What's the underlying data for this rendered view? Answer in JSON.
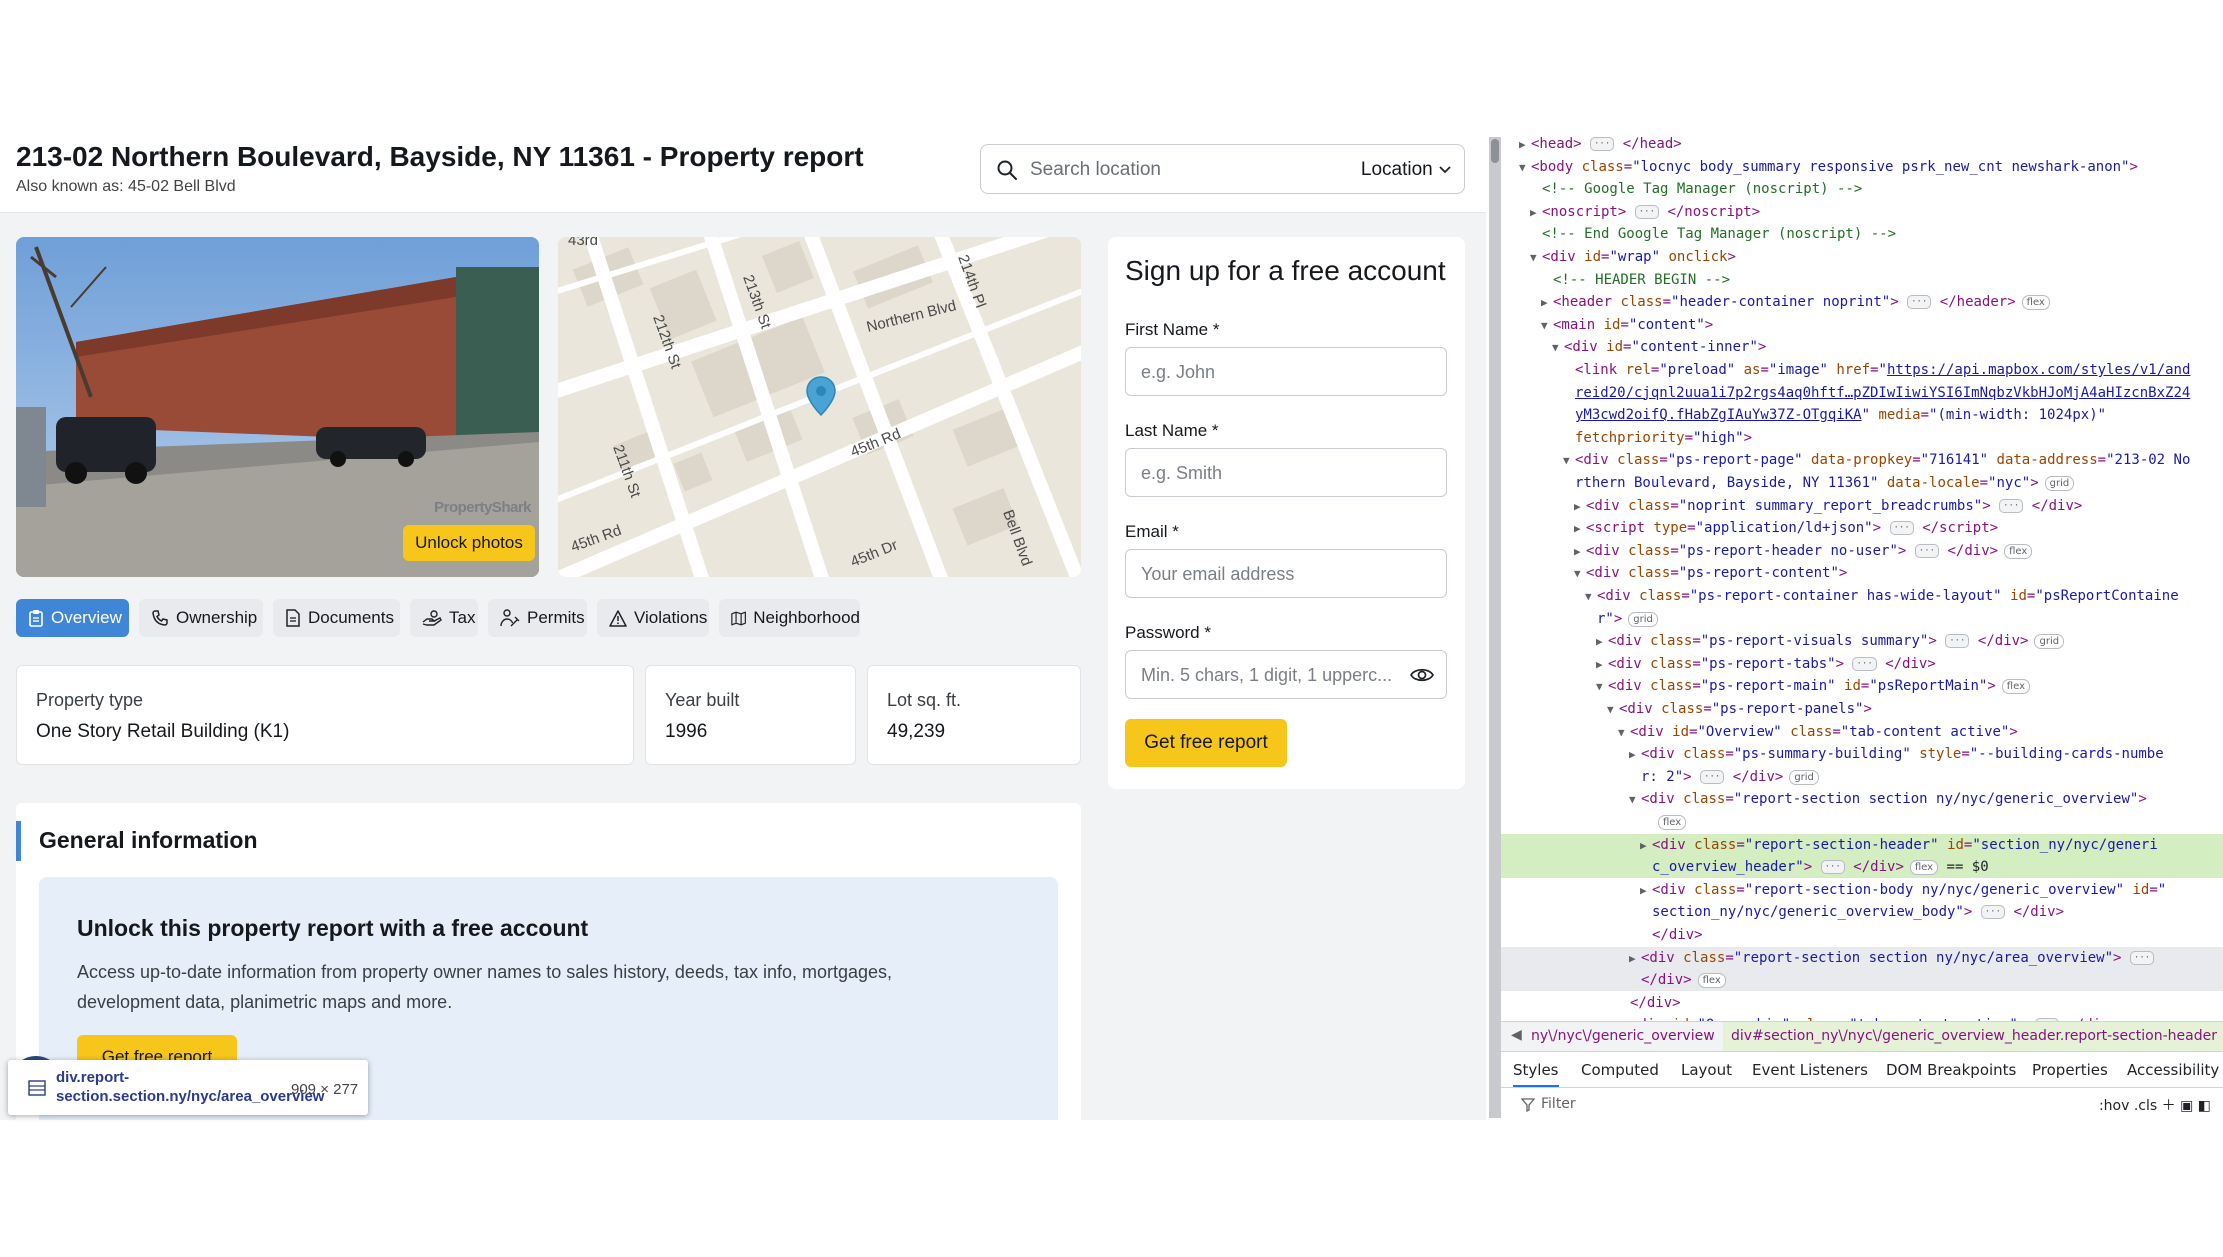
{
  "header": {
    "title": "213-02 Northern Boulevard, Bayside, NY 11361 - Property report",
    "aka": "Also known as: 45-02 Bell Blvd",
    "search_placeholder": "Search location",
    "location_label": "Location"
  },
  "visuals": {
    "unlock_photos": "Unlock photos",
    "watermark": "PropertyShark",
    "map_labels": [
      "43rd",
      "214th Pl",
      "213th St",
      "212th St",
      "Northern Blvd",
      "45th Rd",
      "211th St",
      "45th Rd",
      "45th Dr",
      "Bell Blvd"
    ]
  },
  "tabs": [
    {
      "label": "Overview",
      "icon": "clipboard-icon",
      "active": true
    },
    {
      "label": "Ownership",
      "icon": "phone-icon"
    },
    {
      "label": "Documents",
      "icon": "document-icon"
    },
    {
      "label": "Tax",
      "icon": "hand-coins-icon"
    },
    {
      "label": "Permits",
      "icon": "worker-icon"
    },
    {
      "label": "Violations",
      "icon": "warning-icon"
    },
    {
      "label": "Neighborhood",
      "icon": "map-icon"
    }
  ],
  "cards": [
    {
      "label": "Property type",
      "value": "One Story Retail Building (K1)"
    },
    {
      "label": "Year built",
      "value": "1996"
    },
    {
      "label": "Lot sq. ft.",
      "value": "49,239"
    }
  ],
  "general": {
    "title": "General information",
    "unlock_title": "Unlock this property report with a free account",
    "unlock_desc": "Access up-to-date information from property owner names to sales history, deeds, tax info, mortgages, development data, planimetric maps and more.",
    "unlock_btn": "Get free report"
  },
  "signup": {
    "title": "Sign up for a free account",
    "first_name_label": "First Name *",
    "first_name_ph": "e.g. John",
    "last_name_label": "Last Name *",
    "last_name_ph": "e.g. Smith",
    "email_label": "Email *",
    "email_ph": "Your email address",
    "password_label": "Password *",
    "password_ph": "Min. 5 chars, 1 digit, 1 upperc...",
    "button": "Get free report"
  },
  "tooltip": {
    "selector": "div.report-section.section.ny/nyc/area_overview",
    "size": "909 × 277"
  },
  "devtools": {
    "lines": [
      {
        "tri": "▶",
        "html": "<span class=\"tg\">&lt;head&gt;</span> <span class=\"dots\">···</span> <span class=\"tg\">&lt;/head&gt;</span>"
      },
      {
        "tri": "▼",
        "html": "<span class=\"tg\">&lt;body</span> <span class=\"at\">class</span>=<span class=\"av\">\"locnyc body_summary responsive psrk_new_cnt newshark-anon\"</span><span class=\"tg\">&gt;</span>"
      },
      {
        "tri": "",
        "html": "<span class=\"cm\">&lt;!-- Google Tag Manager (noscript) --&gt;</span>"
      },
      {
        "tri": "▶",
        "html": "<span class=\"tg\">&lt;noscript&gt;</span> <span class=\"dots\">···</span> <span class=\"tg\">&lt;/noscript&gt;</span>"
      },
      {
        "tri": "",
        "html": "<span class=\"cm\">&lt;!-- End Google Tag Manager (noscript) --&gt;</span>"
      },
      {
        "tri": "▼",
        "html": "<span class=\"tg\">&lt;div</span> <span class=\"at\">id</span>=<span class=\"av\">\"wrap\"</span> <span class=\"at\">onclick</span><span class=\"tg\">&gt;</span>"
      },
      {
        "tri": "",
        "html": "<span class=\"cm\">&lt;!-- HEADER BEGIN --&gt;</span>"
      },
      {
        "tri": "▶",
        "html": "<span class=\"tg\">&lt;header</span> <span class=\"at\">class</span>=<span class=\"av\">\"header-container noprint\"</span><span class=\"tg\">&gt;</span> <span class=\"dots\">···</span> <span class=\"tg\">&lt;/header&gt;</span><span class=\"badge\">flex</span>"
      },
      {
        "tri": "▼",
        "html": "<span class=\"tg\">&lt;main</span> <span class=\"at\">id</span>=<span class=\"av\">\"content\"</span><span class=\"tg\">&gt;</span>"
      },
      {
        "tri": "▼",
        "html": "<span class=\"tg\">&lt;div</span> <span class=\"at\">id</span>=<span class=\"av\">\"content-inner\"</span><span class=\"tg\">&gt;</span>"
      },
      {
        "tri": "",
        "html": "<span class=\"tg\">&lt;link</span> <span class=\"at\">rel</span>=<span class=\"av\">\"preload\"</span> <span class=\"at\">as</span>=<span class=\"av\">\"image\"</span> <span class=\"at\">href</span>=<span class=\"av\">\"</span><span class=\"lk\">https://api.mapbox.com/styles/v1/and</span>"
      },
      {
        "tri": "",
        "html": "<span class=\"lk\">reid20/cjqnl2uua1i7p2rgs4aq0hftf…pZDIwIiwiYSI6ImNqbzVkbHJoMjA4aHIzcnBxZ24</span>"
      },
      {
        "tri": "",
        "html": "<span class=\"lk\">yM3cwd2oifQ.fHabZgIAuYw37Z-OTgqiKA</span><span class=\"av\">\"</span> <span class=\"at\">media</span>=<span class=\"av\">\"(min-width: 1024px)\"</span>"
      },
      {
        "tri": "",
        "html": "<span class=\"at\">fetchpriority</span>=<span class=\"av\">\"high\"</span><span class=\"tg\">&gt;</span>"
      },
      {
        "tri": "▼",
        "html": "<span class=\"tg\">&lt;div</span> <span class=\"at\">class</span>=<span class=\"av\">\"ps-report-page\"</span> <span class=\"at\">data-propkey</span>=<span class=\"av\">\"716141\"</span> <span class=\"at\">data-address</span>=<span class=\"av\">\"213-02 No</span>"
      },
      {
        "tri": "",
        "html": "<span class=\"av\">rthern Boulevard, Bayside, NY 11361\"</span> <span class=\"at\">data-locale</span>=<span class=\"av\">\"nyc\"</span><span class=\"tg\">&gt;</span><span class=\"badge\">grid</span>"
      },
      {
        "tri": "▶",
        "html": "<span class=\"tg\">&lt;div</span> <span class=\"at\">class</span>=<span class=\"av\">\"noprint summary_report_breadcrumbs\"</span><span class=\"tg\">&gt;</span> <span class=\"dots\">···</span> <span class=\"tg\">&lt;/div&gt;</span>"
      },
      {
        "tri": "▶",
        "html": "<span class=\"tg\">&lt;script</span> <span class=\"at\">type</span>=<span class=\"av\">\"application/ld+json\"</span><span class=\"tg\">&gt;</span> <span class=\"dots\">···</span> <span class=\"tg\">&lt;/script&gt;</span>"
      },
      {
        "tri": "▶",
        "html": "<span class=\"tg\">&lt;div</span> <span class=\"at\">class</span>=<span class=\"av\">\"ps-report-header  no-user\"</span><span class=\"tg\">&gt;</span> <span class=\"dots\">···</span> <span class=\"tg\">&lt;/div&gt;</span><span class=\"badge\">flex</span>"
      },
      {
        "tri": "▼",
        "html": "<span class=\"tg\">&lt;div</span> <span class=\"at\">class</span>=<span class=\"av\">\"ps-report-content\"</span><span class=\"tg\">&gt;</span>"
      },
      {
        "tri": "▼",
        "html": "<span class=\"tg\">&lt;div</span> <span class=\"at\">class</span>=<span class=\"av\">\"ps-report-container has-wide-layout\"</span> <span class=\"at\">id</span>=<span class=\"av\">\"psReportContaine</span>"
      },
      {
        "tri": "",
        "html": "<span class=\"av\">r\"</span><span class=\"tg\">&gt;</span><span class=\"badge\">grid</span>"
      },
      {
        "tri": "▶",
        "html": "<span class=\"tg\">&lt;div</span> <span class=\"at\">class</span>=<span class=\"av\">\"ps-report-visuals summary\"</span><span class=\"tg\">&gt;</span> <span class=\"dots\">···</span> <span class=\"tg\">&lt;/div&gt;</span><span class=\"badge\">grid</span>"
      },
      {
        "tri": "▶",
        "html": "<span class=\"tg\">&lt;div</span> <span class=\"at\">class</span>=<span class=\"av\">\"ps-report-tabs\"</span><span class=\"tg\">&gt;</span> <span class=\"dots\">···</span> <span class=\"tg\">&lt;/div&gt;</span>"
      },
      {
        "tri": "▼",
        "html": "<span class=\"tg\">&lt;div</span> <span class=\"at\">class</span>=<span class=\"av\">\"ps-report-main\"</span> <span class=\"at\">id</span>=<span class=\"av\">\"psReportMain\"</span><span class=\"tg\">&gt;</span><span class=\"badge\">flex</span>"
      },
      {
        "tri": "▼",
        "html": "<span class=\"tg\">&lt;div</span> <span class=\"at\">class</span>=<span class=\"av\">\"ps-report-panels\"</span><span class=\"tg\">&gt;</span>"
      },
      {
        "tri": "▼",
        "html": "<span class=\"tg\">&lt;div</span> <span class=\"at\">id</span>=<span class=\"av\">\"Overview\"</span> <span class=\"at\">class</span>=<span class=\"av\">\"tab-content active\"</span><span class=\"tg\">&gt;</span>"
      },
      {
        "tri": "▶",
        "html": "<span class=\"tg\">&lt;div</span> <span class=\"at\">class</span>=<span class=\"av\">\"ps-summary-building\"</span> <span class=\"at\">style</span>=<span class=\"av\">\"--building-cards-numbe</span>"
      },
      {
        "tri": "",
        "html": "<span class=\"av\">r: 2\"</span><span class=\"tg\">&gt;</span> <span class=\"dots\">···</span> <span class=\"tg\">&lt;/div&gt;</span><span class=\"badge\">grid</span>"
      },
      {
        "tri": "▼",
        "html": "<span class=\"tg\">&lt;div</span> <span class=\"at\">class</span>=<span class=\"av\">\"report-section section ny/nyc/generic_overview\"</span><span class=\"tg\">&gt;</span>"
      },
      {
        "tri": "",
        "html": "<span class=\"badge\">flex</span>"
      },
      {
        "tri": "▶",
        "hl": true,
        "html": "<span class=\"tg\">&lt;div</span> <span class=\"at\">class</span>=<span class=\"av\">\"report-section-header\"</span> <span class=\"at\">id</span>=<span class=\"av\">\"section_ny/nyc/generi</span>"
      },
      {
        "tri": "",
        "hl": true,
        "html": "<span class=\"av\">c_overview_header\"</span><span class=\"tg\">&gt;</span> <span class=\"dots\">···</span> <span class=\"tg\">&lt;/div&gt;</span><span class=\"badge\">flex</span> <span class=\"tx\">== $0</span>"
      },
      {
        "tri": "▶",
        "html": "<span class=\"tg\">&lt;div</span> <span class=\"at\">class</span>=<span class=\"av\">\"report-section-body ny/nyc/generic_overview\"</span> <span class=\"at\">id</span>=<span class=\"av\">\"</span>"
      },
      {
        "tri": "",
        "html": "<span class=\"av\">section_ny/nyc/generic_overview_body\"</span><span class=\"tg\">&gt;</span> <span class=\"dots\">···</span> <span class=\"tg\">&lt;/div&gt;</span>"
      },
      {
        "tri": "",
        "html": "<span class=\"tg\">&lt;/div&gt;</span>"
      },
      {
        "tri": "▶",
        "hl2": true,
        "html": "<span class=\"tg\">&lt;div</span> <span class=\"at\">class</span>=<span class=\"av\">\"report-section section ny/nyc/area_overview\"</span><span class=\"tg\">&gt;</span> <span class=\"dots\">···</span>"
      },
      {
        "tri": "",
        "hl2": true,
        "html": "<span class=\"tg\">&lt;/div&gt;</span><span class=\"badge\">flex</span>"
      },
      {
        "tri": "",
        "html": "<span class=\"tg\">&lt;/div&gt;</span>"
      },
      {
        "tri": "▶",
        "html": "<span class=\"tg\">&lt;div</span> <span class=\"at\">id</span>=<span class=\"av\">\"Ownership\"</span> <span class=\"at\">class</span>=<span class=\"av\">\"tab-content active\"</span><span class=\"tg\">&gt;</span> <span class=\"dots\">···</span> <span class=\"tg\">&lt;/div&gt;</span>"
      }
    ],
    "breadcrumb_1": "ny\\/nyc\\/generic_overview",
    "breadcrumb_2": "div#section_ny\\/nyc\\/generic_overview_header.report-section-header",
    "tabs": [
      "Styles",
      "Computed",
      "Layout",
      "Event Listeners",
      "DOM Breakpoints",
      "Properties",
      "Accessibility"
    ],
    "filter_placeholder": "Filter",
    "filter_right": ":hov  .cls"
  }
}
